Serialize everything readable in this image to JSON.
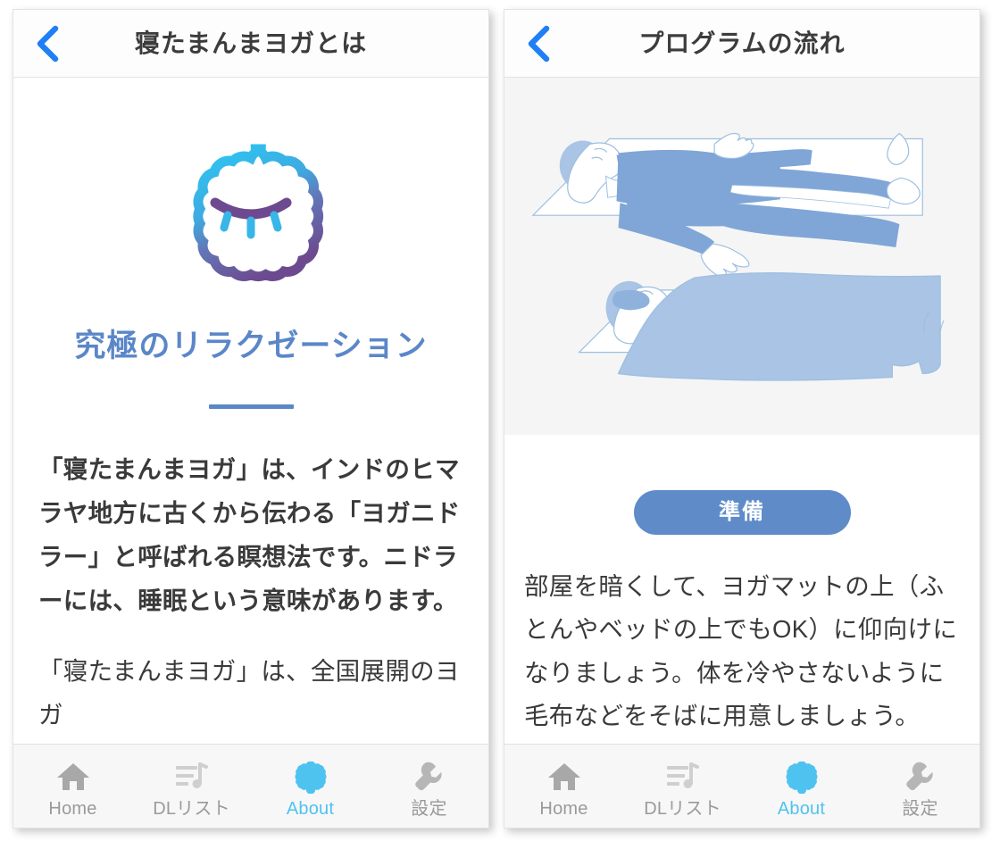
{
  "theme": {
    "accent_blue": "#5b87c8",
    "link_blue": "#1f7ff5",
    "active_cyan": "#4ec3f0",
    "text_gray": "#3a3a3a",
    "tab_gray": "#9a9a9a",
    "illustration_bg": "#f5f5f5"
  },
  "left_screen": {
    "nav": {
      "back_icon": "chevron-left-icon",
      "title": "寝たまんまヨガとは"
    },
    "logo": {
      "icon": "sleeping-face-cloud-logo",
      "description": "閉じた目のクラウド型ロゴ"
    },
    "headline": "究極のリラクゼーション",
    "paragraphs": [
      {
        "style": "bold",
        "text": "「寝たまんまヨガ」は、インドのヒマラヤ地方に古くから伝わる「ヨガニドラー」と呼ばれる瞑想法です。ニドラーには、睡眠という意味があります。"
      },
      {
        "style": "normal",
        "text": "「寝たまんまヨガ」は、全国展開のヨガ"
      }
    ]
  },
  "right_screen": {
    "nav": {
      "back_icon": "chevron-left-icon",
      "title": "プログラムの流れ"
    },
    "illustration": {
      "icon": "savasana-illustration",
      "description": "ヨガマットの上で仰向けに寝ている2人のイラスト（上は毛布なし、下は毛布あり）"
    },
    "section_button": "準備",
    "body_text": "部屋を暗くして、ヨガマットの上（ふとんやベッドの上でもOK）に仰向けになりましょう。体を冷やさないように毛布などをそばに用意しましょう。"
  },
  "tabbar": {
    "items": [
      {
        "icon": "home-icon",
        "label": "Home",
        "active": false
      },
      {
        "icon": "playlist-music-icon",
        "label": "DLリスト",
        "active": false
      },
      {
        "icon": "cloud-blob-icon",
        "label": "About",
        "active": true
      },
      {
        "icon": "wrench-icon",
        "label": "設定",
        "active": false
      }
    ]
  }
}
